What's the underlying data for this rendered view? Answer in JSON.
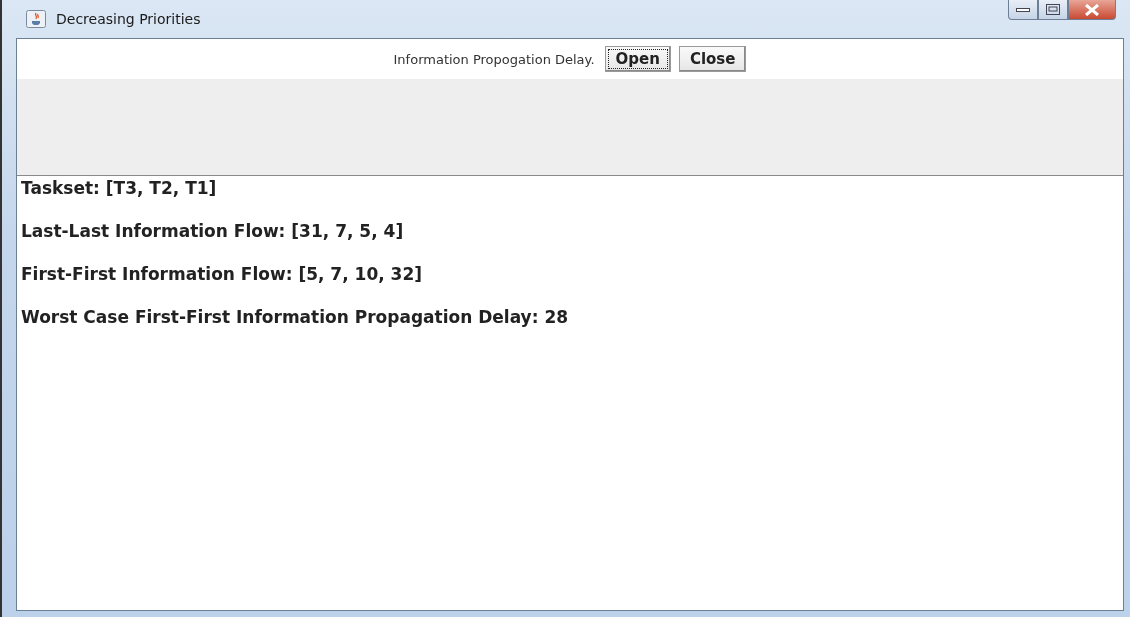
{
  "window": {
    "title": "Decreasing Priorities"
  },
  "toolbar": {
    "label": "Information Propogation Delay.",
    "buttons": [
      {
        "label": "Open",
        "focused": true
      },
      {
        "label": "Close",
        "focused": false
      }
    ]
  },
  "output_lines": [
    "Taskset: [T3, T2, T1]",
    "Last-Last Information Flow: [31, 7, 5, 4]",
    "First-First Information Flow: [5, 7, 10, 32]",
    "Worst Case First-First Information Propagation Delay: 28"
  ]
}
